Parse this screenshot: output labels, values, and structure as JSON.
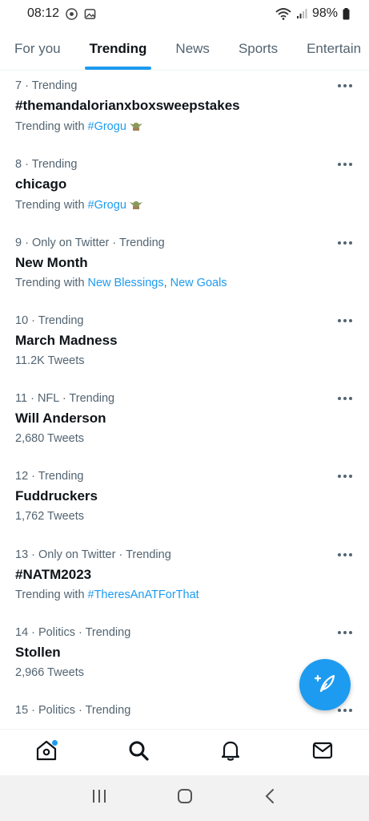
{
  "status_bar": {
    "time": "08:12",
    "battery": "98%"
  },
  "tabs": [
    {
      "label": "For you"
    },
    {
      "label": "Trending"
    },
    {
      "label": "News"
    },
    {
      "label": "Sports"
    },
    {
      "label": "Entertain"
    }
  ],
  "trends": [
    {
      "meta": "7 · Trending",
      "title": "#themandalorianxboxsweepstakes",
      "sub_prefix": "Trending with",
      "sub_link": "#Grogu",
      "sub_sep": "",
      "sub_link2": "",
      "count": ""
    },
    {
      "meta": "8 · Trending",
      "title": "chicago",
      "sub_prefix": "Trending with",
      "sub_link": "#Grogu",
      "sub_sep": "",
      "sub_link2": "",
      "count": ""
    },
    {
      "meta": "9 · Only on Twitter · Trending",
      "title": "New Month",
      "sub_prefix": "Trending with",
      "sub_link": "New Blessings",
      "sub_sep": ",",
      "sub_link2": "New Goals",
      "count": ""
    },
    {
      "meta": "10 · Trending",
      "title": "March Madness",
      "count": "11.2K Tweets"
    },
    {
      "meta": "11 · NFL · Trending",
      "title": "Will Anderson",
      "count": "2,680 Tweets"
    },
    {
      "meta": "12 · Trending",
      "title": "Fuddruckers",
      "count": "1,762 Tweets"
    },
    {
      "meta": "13 · Only on Twitter · Trending",
      "title": "#NATM2023",
      "sub_prefix": "Trending with",
      "sub_link": "#TheresAnATForThat",
      "sub_sep": "",
      "sub_link2": "",
      "count": ""
    },
    {
      "meta": "14 · Politics · Trending",
      "title": "Stollen",
      "count": "2,966 Tweets"
    },
    {
      "meta": "15 · Politics · Trending",
      "title": "",
      "count": ""
    }
  ],
  "icons": {
    "home": "home-icon",
    "search": "search-icon",
    "notifications": "bell-icon",
    "messages": "mail-icon",
    "compose": "compose-tweet-icon",
    "grogu_emoji": "grogu-emoji-icon"
  },
  "colors": {
    "accent": "#1d9bf0",
    "text": "#0f1419",
    "muted": "#536471"
  }
}
